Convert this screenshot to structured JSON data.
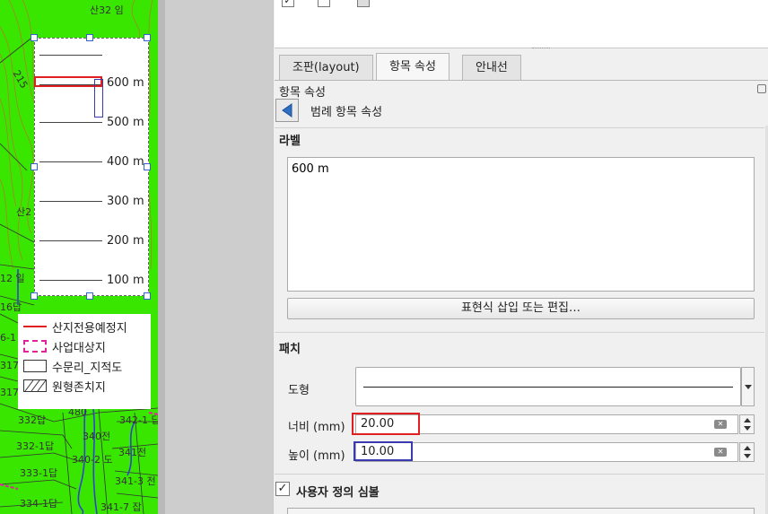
{
  "map": {
    "top_labels": {
      "parcel_top": "산32 임",
      "road_215": "215",
      "san2": "산2",
      "p12": "12 일",
      "p16": "16답",
      "p6_1": "6-1",
      "p317a": "317",
      "p317b": "317",
      "p480": "480",
      "p332": "332답",
      "p342_1": "342-1 답",
      "p340": "340전",
      "p332_1": "332-1답",
      "p340_2": "340-2 도",
      "p341": "341전",
      "p333_1": "333-1답",
      "p341_3": "341-3 전",
      "p334_1": "334-1답",
      "p341_7": "341-7 잡"
    },
    "scale_labels": [
      "600 m",
      "500 m",
      "400 m",
      "300 m",
      "200 m",
      "100 m"
    ],
    "legend_items": [
      {
        "label": "산지전용예정지",
        "symbol": "red-line-icon"
      },
      {
        "label": "사업대상지",
        "symbol": "pink-dashed-rect-icon"
      },
      {
        "label": "수문리_지적도",
        "symbol": "white-rect-icon"
      },
      {
        "label": "원형존치지",
        "symbol": "hatched-rect-icon"
      }
    ]
  },
  "panel": {
    "tabs": [
      {
        "label": "조판(layout)"
      },
      {
        "label": "항목 속성"
      },
      {
        "label": "안내선"
      }
    ],
    "properties_title": "항목 속성",
    "back_label": "범례 항목 속성",
    "label_section": "라벨",
    "label_text": "600 m",
    "expression_button": "표현식 삽입 또는 편집…",
    "patch_section": "패치",
    "shape_label": "도형",
    "width_label": "너비 (mm)",
    "width_value": "20.00",
    "height_label": "높이 (mm)",
    "height_value": "10.00",
    "custom_symbol_label": "사용자 정의 심볼",
    "custom_symbol_checked": "✓"
  },
  "colors": {
    "map_green": "#39e600",
    "highlight_red": "#e02020",
    "highlight_blue": "#3a3ab0",
    "legend_pink": "#e0209c"
  }
}
